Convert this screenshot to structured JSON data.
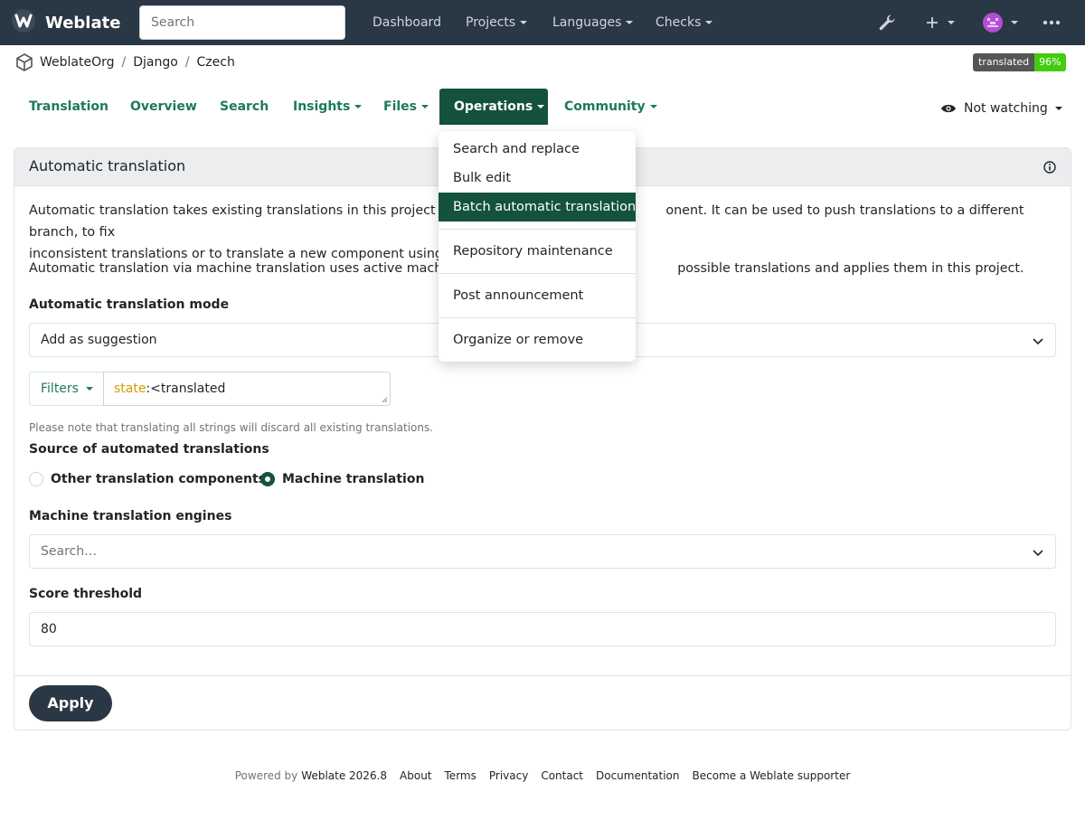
{
  "navbar": {
    "brand": "Weblate",
    "search_placeholder": "Search",
    "links": [
      {
        "label": "Dashboard"
      },
      {
        "label": "Projects"
      },
      {
        "label": "Languages"
      },
      {
        "label": "Checks"
      }
    ],
    "icons": [
      "wrench-icon",
      "plus-icon",
      "avatar-icon",
      "more-icon"
    ]
  },
  "breadcrumb": {
    "items": [
      "WeblateOrg",
      "Django",
      "Czech"
    ],
    "separator": "/"
  },
  "badge": {
    "label": "translated",
    "value": "96%"
  },
  "tabs": [
    {
      "label": "Translation"
    },
    {
      "label": "Overview"
    },
    {
      "label": "Search"
    },
    {
      "label": "Insights"
    },
    {
      "label": "Files"
    },
    {
      "label": "Operations"
    },
    {
      "label": "Community"
    }
  ],
  "watch": {
    "label": "Not watching"
  },
  "operations_menu": {
    "items": [
      {
        "label": "Search and replace"
      },
      {
        "label": "Bulk edit"
      },
      {
        "label": "Batch automatic translation"
      },
      {
        "label": "Repository maintenance"
      },
      {
        "label": "Post announcement"
      },
      {
        "label": "Organize or remove"
      }
    ]
  },
  "card": {
    "title": "Automatic translation",
    "para1_a": "Automatic translation takes existing translations in this project and a",
    "para1_b": "onent. It can be used to push translations to a different branch, to fix",
    "para1_c": "inconsistent translations or to translate a new component using tran",
    "para2_a": "Automatic translation via machine translation uses active machine tr",
    "para2_b": "possible translations and applies them in this project.",
    "mode_label": "Automatic translation mode",
    "mode_value": "Add as suggestion",
    "filters_label": "Filters",
    "filter_key": "state",
    "filter_rest": ":<translated",
    "note": "Please note that translating all strings will discard all existing translations.",
    "source_label": "Source of automated translations",
    "source_options": [
      {
        "label": "Other translation components",
        "checked": false
      },
      {
        "label": "Machine translation",
        "checked": true
      }
    ],
    "engines_label": "Machine translation engines",
    "engines_placeholder": "Search…",
    "threshold_label": "Score threshold",
    "threshold_value": "80",
    "apply_label": "Apply"
  },
  "footer": {
    "powered_by": "Powered by",
    "links": [
      {
        "label": "Weblate 2026.8"
      },
      {
        "label": "About"
      },
      {
        "label": "Terms"
      },
      {
        "label": "Privacy"
      },
      {
        "label": "Contact"
      },
      {
        "label": "Documentation"
      },
      {
        "label": "Become a Weblate supporter"
      }
    ]
  }
}
